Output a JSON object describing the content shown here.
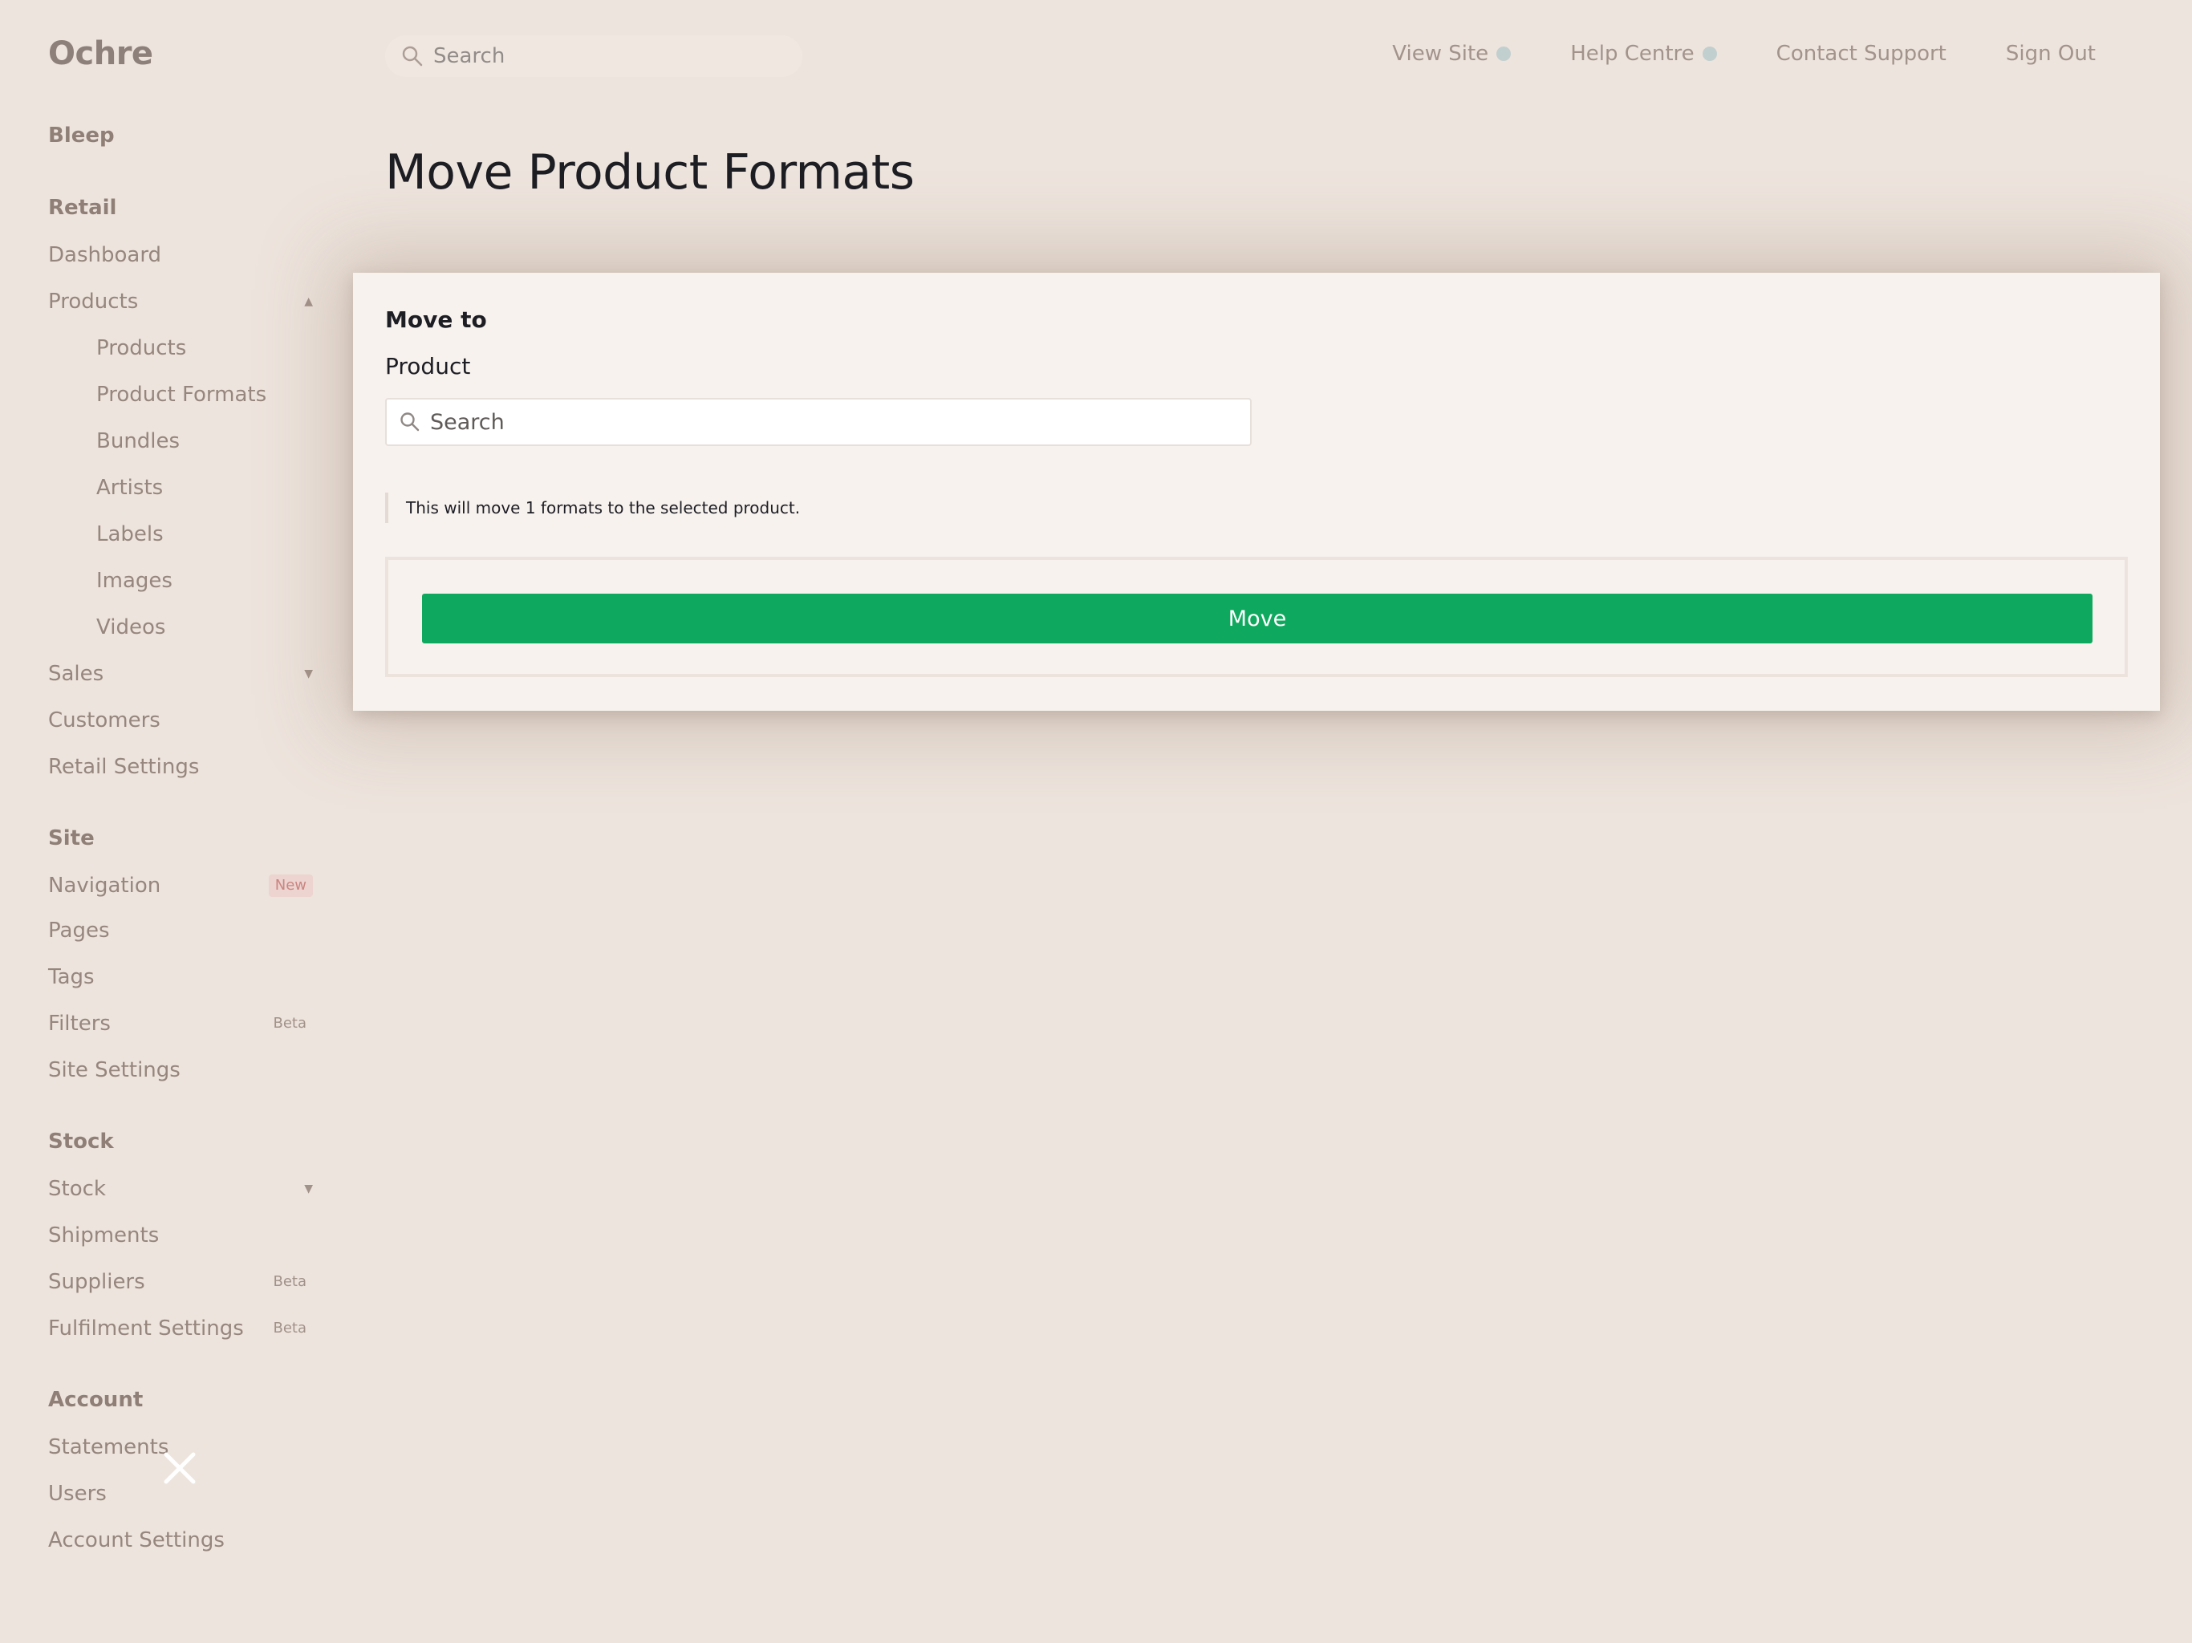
{
  "brand": "Ochre",
  "topbar": {
    "search_placeholder": "Search",
    "links": [
      "View Site",
      "Help Centre",
      "Contact Support",
      "Sign Out"
    ]
  },
  "sidebar": {
    "account_name": "Bleep",
    "sections": [
      {
        "heading": "Retail",
        "items": [
          {
            "label": "Dashboard"
          },
          {
            "label": "Products",
            "expanded": true
          },
          {
            "label": "Products",
            "sub": true
          },
          {
            "label": "Product Formats",
            "sub": true
          },
          {
            "label": "Bundles",
            "sub": true
          },
          {
            "label": "Artists",
            "sub": true
          },
          {
            "label": "Labels",
            "sub": true
          },
          {
            "label": "Images",
            "sub": true
          },
          {
            "label": "Videos",
            "sub": true
          },
          {
            "label": "Sales",
            "expandable": true
          },
          {
            "label": "Customers"
          },
          {
            "label": "Retail Settings"
          }
        ]
      },
      {
        "heading": "Site",
        "items": [
          {
            "label": "Navigation",
            "badge": "New"
          },
          {
            "label": "Pages"
          },
          {
            "label": "Tags"
          },
          {
            "label": "Filters",
            "badge": "Beta"
          },
          {
            "label": "Site Settings"
          }
        ]
      },
      {
        "heading": "Stock",
        "items": [
          {
            "label": "Stock",
            "expandable": true
          },
          {
            "label": "Shipments"
          },
          {
            "label": "Suppliers",
            "badge": "Beta"
          },
          {
            "label": "Fulfilment Settings",
            "badge": "Beta"
          }
        ]
      },
      {
        "heading": "Account",
        "items": [
          {
            "label": "Statements"
          },
          {
            "label": "Users"
          },
          {
            "label": "Account Settings"
          }
        ]
      }
    ]
  },
  "page": {
    "title": "Move Product Formats"
  },
  "modal": {
    "heading": "Move to",
    "field_label": "Product",
    "search_placeholder": "Search",
    "notice": "This will move 1 formats to the selected product.",
    "button_label": "Move",
    "button_color": "#0ea95e"
  },
  "colors": {
    "accent_green": "#0ea95e",
    "background": "#f7f2ee",
    "title_text": "#1d1d24"
  }
}
